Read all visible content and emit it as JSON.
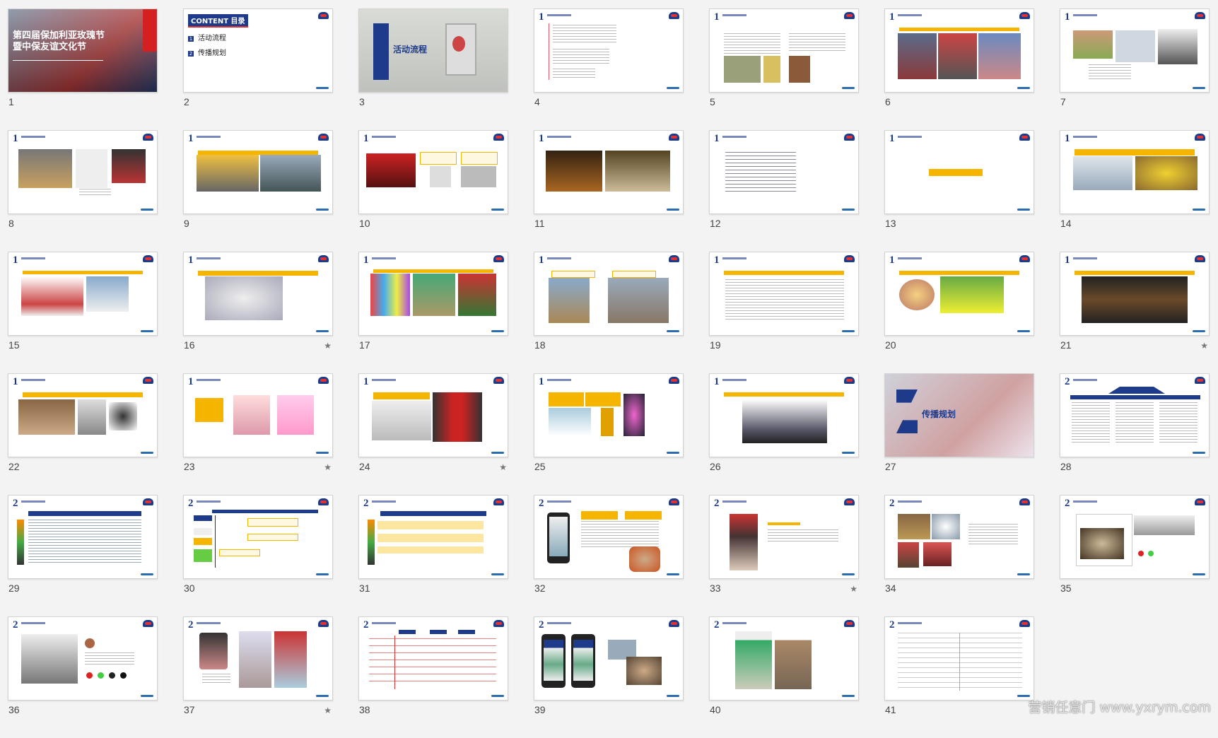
{
  "slides": [
    {
      "num": "1",
      "starred": false,
      "text": "第四届保加利亚玫瑰节暨中保友谊文化节"
    },
    {
      "num": "2",
      "starred": false,
      "text": "CONTENT 目录",
      "items": [
        "活动流程",
        "传播规划"
      ]
    },
    {
      "num": "3",
      "starred": false,
      "text": "活动流程"
    },
    {
      "num": "4",
      "starred": false
    },
    {
      "num": "5",
      "starred": false
    },
    {
      "num": "6",
      "starred": false
    },
    {
      "num": "7",
      "starred": false
    },
    {
      "num": "8",
      "starred": false
    },
    {
      "num": "9",
      "starred": false
    },
    {
      "num": "10",
      "starred": false
    },
    {
      "num": "11",
      "starred": false
    },
    {
      "num": "12",
      "starred": false
    },
    {
      "num": "13",
      "starred": false
    },
    {
      "num": "14",
      "starred": false
    },
    {
      "num": "15",
      "starred": false
    },
    {
      "num": "16",
      "starred": true
    },
    {
      "num": "17",
      "starred": false
    },
    {
      "num": "18",
      "starred": false
    },
    {
      "num": "19",
      "starred": false
    },
    {
      "num": "20",
      "starred": false
    },
    {
      "num": "21",
      "starred": true
    },
    {
      "num": "22",
      "starred": false
    },
    {
      "num": "23",
      "starred": true
    },
    {
      "num": "24",
      "starred": true
    },
    {
      "num": "25",
      "starred": false
    },
    {
      "num": "26",
      "starred": false
    },
    {
      "num": "27",
      "starred": false,
      "text": "传播规划"
    },
    {
      "num": "28",
      "starred": false
    },
    {
      "num": "29",
      "starred": false
    },
    {
      "num": "30",
      "starred": false
    },
    {
      "num": "31",
      "starred": false
    },
    {
      "num": "32",
      "starred": false
    },
    {
      "num": "33",
      "starred": true
    },
    {
      "num": "34",
      "starred": false
    },
    {
      "num": "35",
      "starred": false
    },
    {
      "num": "36",
      "starred": false
    },
    {
      "num": "37",
      "starred": true
    },
    {
      "num": "38",
      "starred": false
    },
    {
      "num": "39",
      "starred": false
    },
    {
      "num": "40",
      "starred": false
    },
    {
      "num": "41",
      "starred": false
    }
  ],
  "star_glyph": "★",
  "watermark": "营销任意门 www.yxrym.com"
}
